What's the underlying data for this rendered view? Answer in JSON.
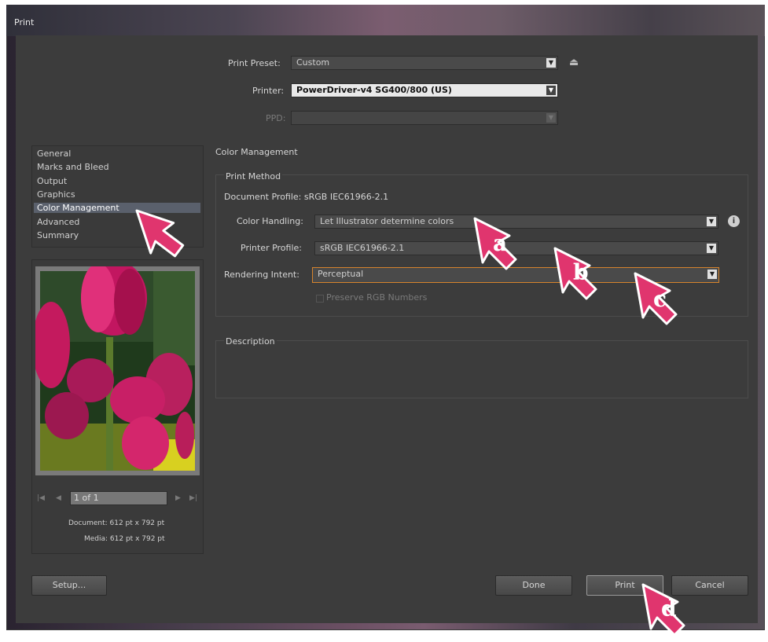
{
  "window": {
    "title": "Print"
  },
  "header": {
    "print_preset_label": "Print Preset:",
    "print_preset_value": "Custom",
    "printer_label": "Printer:",
    "printer_value": "PowerDriver-v4 SG400/800 (US)",
    "ppd_label": "PPD:",
    "ppd_value": ""
  },
  "sidebar": {
    "items": [
      {
        "label": "General"
      },
      {
        "label": "Marks and Bleed"
      },
      {
        "label": "Output"
      },
      {
        "label": "Graphics"
      },
      {
        "label": "Color Management"
      },
      {
        "label": "Advanced"
      },
      {
        "label": "Summary"
      }
    ],
    "selected": "Color Management"
  },
  "preview": {
    "page_field": "1 of 1",
    "document_size": "Document: 612 pt x 792 pt",
    "media_size": "Media: 612 pt x 792 pt"
  },
  "main": {
    "section_title": "Color Management",
    "print_method_title": "Print Method",
    "document_profile": "Document Profile: sRGB IEC61966-2.1",
    "color_handling_label": "Color Handling:",
    "color_handling_value": "Let Illustrator determine colors",
    "printer_profile_label": "Printer Profile:",
    "printer_profile_value": "sRGB IEC61966-2.1",
    "rendering_intent_label": "Rendering Intent:",
    "rendering_intent_value": "Perceptual",
    "preserve_rgb_label": "Preserve RGB Numbers",
    "description_title": "Description"
  },
  "buttons": {
    "setup": "Setup...",
    "done": "Done",
    "print": "Print",
    "cancel": "Cancel"
  },
  "markers": {
    "a": "a",
    "b": "b",
    "c": "c",
    "d": "d"
  },
  "colors": {
    "dialog_bg": "#3c3c3c",
    "selection": "#5a606c",
    "focus_border": "#d6832c",
    "marker": "#e0356e"
  },
  "icons": {
    "preset_save": "printer-save-icon",
    "info": "info-icon",
    "dropdown": "chevron-down-icon"
  }
}
